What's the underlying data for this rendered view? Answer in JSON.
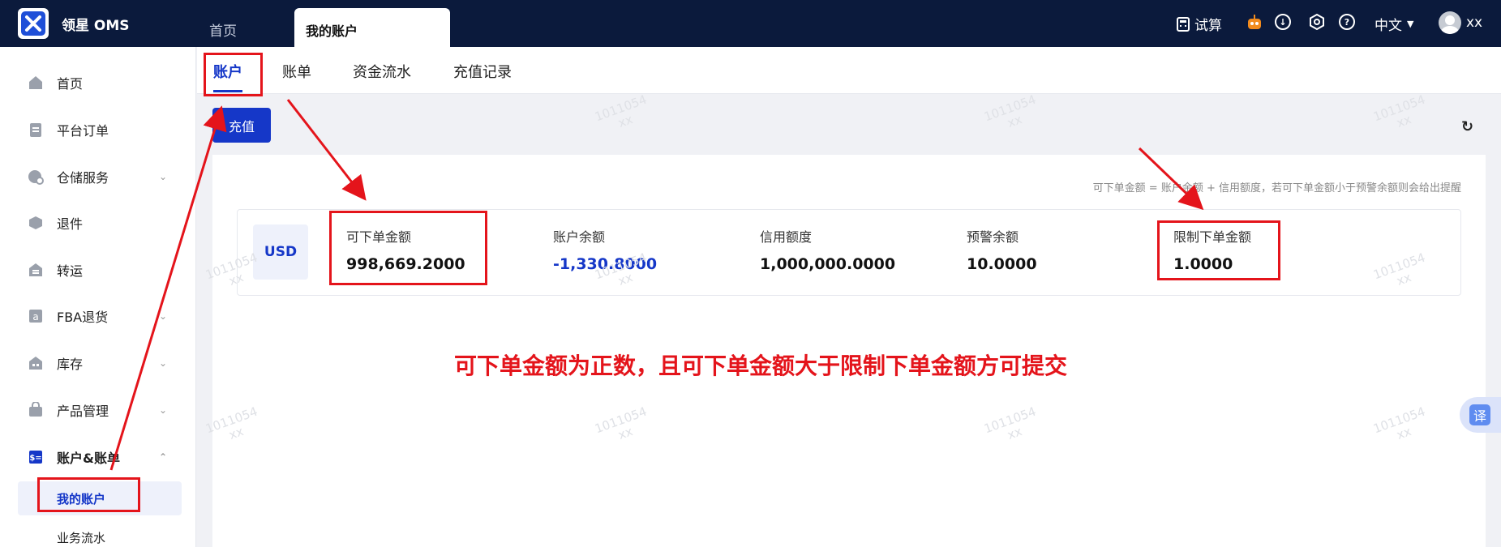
{
  "app": {
    "title": "领星 OMS"
  },
  "topbar": {
    "tabs": [
      {
        "label": "首页"
      },
      {
        "label": "我的账户"
      }
    ],
    "trial_label": "试算",
    "language": "中文",
    "user": "xx"
  },
  "sidebar": {
    "items": [
      {
        "label": "首页"
      },
      {
        "label": "平台订单"
      },
      {
        "label": "仓储服务"
      },
      {
        "label": "退件"
      },
      {
        "label": "转运"
      },
      {
        "label": "FBA退货"
      },
      {
        "label": "库存"
      },
      {
        "label": "产品管理"
      },
      {
        "label": "账户&账单"
      }
    ],
    "sub_items": [
      {
        "label": "我的账户"
      },
      {
        "label": "业务流水"
      }
    ]
  },
  "content_tabs": [
    {
      "label": "账户"
    },
    {
      "label": "账单"
    },
    {
      "label": "资金流水"
    },
    {
      "label": "充值记录"
    }
  ],
  "toolbar": {
    "recharge_label": "充值"
  },
  "panel": {
    "hint": "可下单金额 = 账户余额 + 信用额度，若可下单金额小于预警余额则会给出提醒",
    "currency": "USD",
    "stats": [
      {
        "label": "可下单金额",
        "value": "998,669.2000"
      },
      {
        "label": "账户余额",
        "value": "-1,330.8000"
      },
      {
        "label": "信用额度",
        "value": "1,000,000.0000"
      },
      {
        "label": "预警余额",
        "value": "10.0000"
      },
      {
        "label": "限制下单金额",
        "value": "1.0000"
      }
    ]
  },
  "annotation": {
    "text": "可下单金额为正数，且可下单金额大于限制下单金额方可提交"
  },
  "watermark": {
    "line1": "1011054",
    "line2": "xx"
  },
  "translate_label": "译",
  "colors": {
    "primary": "#1537c8",
    "topbar": "#0b1a3c",
    "annotation": "#e4141b"
  }
}
